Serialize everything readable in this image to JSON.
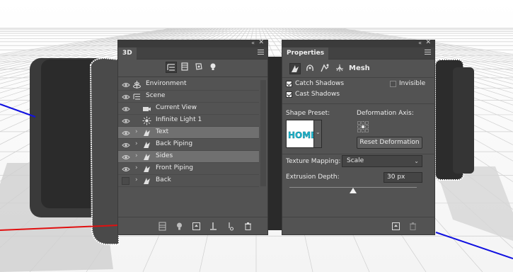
{
  "panel3d": {
    "tab": "3D",
    "filters": [
      {
        "name": "whole-scene-filter-icon",
        "active": true
      },
      {
        "name": "meshes-filter-icon",
        "active": false
      },
      {
        "name": "materials-filter-icon",
        "active": false
      },
      {
        "name": "lights-filter-icon",
        "active": false
      }
    ],
    "layers": [
      {
        "label": "Environment",
        "visible": true,
        "expandable": false,
        "indent": 0,
        "icon": "environment-icon",
        "selected": false
      },
      {
        "label": "Scene",
        "visible": true,
        "expandable": false,
        "indent": 0,
        "icon": "scene-icon",
        "selected": false
      },
      {
        "label": "Current View",
        "visible": true,
        "expandable": false,
        "indent": 1,
        "icon": "camera-icon",
        "selected": false
      },
      {
        "label": "Infinite Light 1",
        "visible": true,
        "expandable": false,
        "indent": 1,
        "icon": "light-icon",
        "selected": false
      },
      {
        "label": "Text",
        "visible": true,
        "expandable": true,
        "indent": 1,
        "icon": "mesh-icon",
        "selected": true
      },
      {
        "label": "Back Piping",
        "visible": true,
        "expandable": true,
        "indent": 1,
        "icon": "mesh-icon",
        "selected": false
      },
      {
        "label": "Sides",
        "visible": true,
        "expandable": true,
        "indent": 1,
        "icon": "mesh-icon",
        "selected": true
      },
      {
        "label": "Front Piping",
        "visible": true,
        "expandable": true,
        "indent": 1,
        "icon": "mesh-icon",
        "selected": false
      },
      {
        "label": "Back",
        "visible": false,
        "expandable": true,
        "indent": 1,
        "icon": "mesh-icon",
        "selected": false
      }
    ],
    "footer_icons": [
      "render-icon",
      "light-bulb-icon",
      "add-constraint-icon",
      "ground-plane-icon",
      "split-constraint-icon",
      "trash-icon"
    ]
  },
  "properties": {
    "tab": "Properties",
    "mesh_tab_label": "Mesh",
    "catch_shadows": {
      "label": "Catch Shadows",
      "checked": true
    },
    "invisible": {
      "label": "Invisible",
      "checked": false
    },
    "cast_shadows": {
      "label": "Cast Shadows",
      "checked": true
    },
    "shape_preset_label": "Shape Preset:",
    "deformation_axis_label": "Deformation Axis:",
    "reset_deformation_label": "Reset Deformation",
    "texture_mapping_label": "Texture Mapping:",
    "texture_mapping_value": "Scale",
    "extrusion_depth_label": "Extrusion Depth:",
    "extrusion_depth_value": "30 px",
    "extrusion_slider_fraction": 0.5,
    "preset_thumbnail_text": "HOME",
    "footer_icons": [
      "render-icon",
      "trash-icon"
    ]
  },
  "colors": {
    "panel_bg": "#535353",
    "accent_cyan": "#1fb7d0",
    "axis_red": "#e01010",
    "axis_blue": "#1010e0"
  }
}
